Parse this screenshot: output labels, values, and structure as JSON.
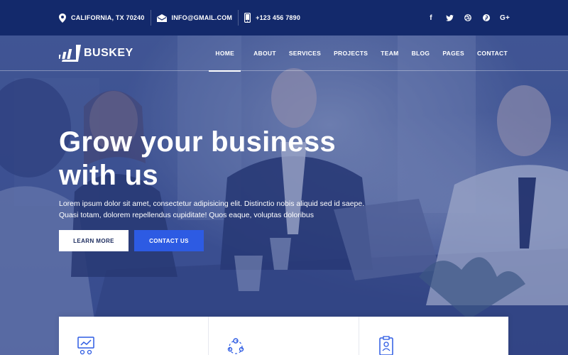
{
  "topbar": {
    "address": "CALIFORNIA, TX 70240",
    "email": "INFO@GMAIL.COM",
    "phone": "+123 456 7890",
    "icons": [
      "map-pin-icon",
      "envelope-icon",
      "phone-icon"
    ],
    "social": [
      "facebook-icon",
      "twitter-icon",
      "dribbble-icon",
      "pinterest-icon",
      "google-plus-icon"
    ],
    "social_glyphs": {
      "facebook": "f",
      "twitter": "🐦",
      "dribbble": "◎",
      "pinterest": "℗",
      "google": "G+"
    }
  },
  "brand": {
    "name": "BUSKEY"
  },
  "nav": {
    "items": [
      {
        "label": "HOME",
        "active": true
      },
      {
        "label": "ABOUT"
      },
      {
        "label": "SERVICES"
      },
      {
        "label": "PROJECTS"
      },
      {
        "label": "TEAM"
      },
      {
        "label": "BLOG"
      },
      {
        "label": "PAGES"
      },
      {
        "label": "CONTACT"
      }
    ]
  },
  "hero": {
    "headline_line1": "Grow your business",
    "headline_line2": "with us",
    "lead": "Lorem ipsum dolor sit amet, consectetur adipisicing elit. Distinctio nobis aliquid sed id saepe. Quasi totam, dolorem repellendus cupiditate! Quos eaque, voluptas doloribus",
    "learn_more_label": "LEARN MORE",
    "contact_label": "CONTACT US"
  },
  "features": {
    "icons": [
      "analytics-presentation-icon",
      "team-network-icon",
      "clipboard-profile-icon"
    ]
  },
  "colors": {
    "topbar": "#13296b",
    "accent": "#2d5be3",
    "hero_overlay": "#4e63a0"
  }
}
